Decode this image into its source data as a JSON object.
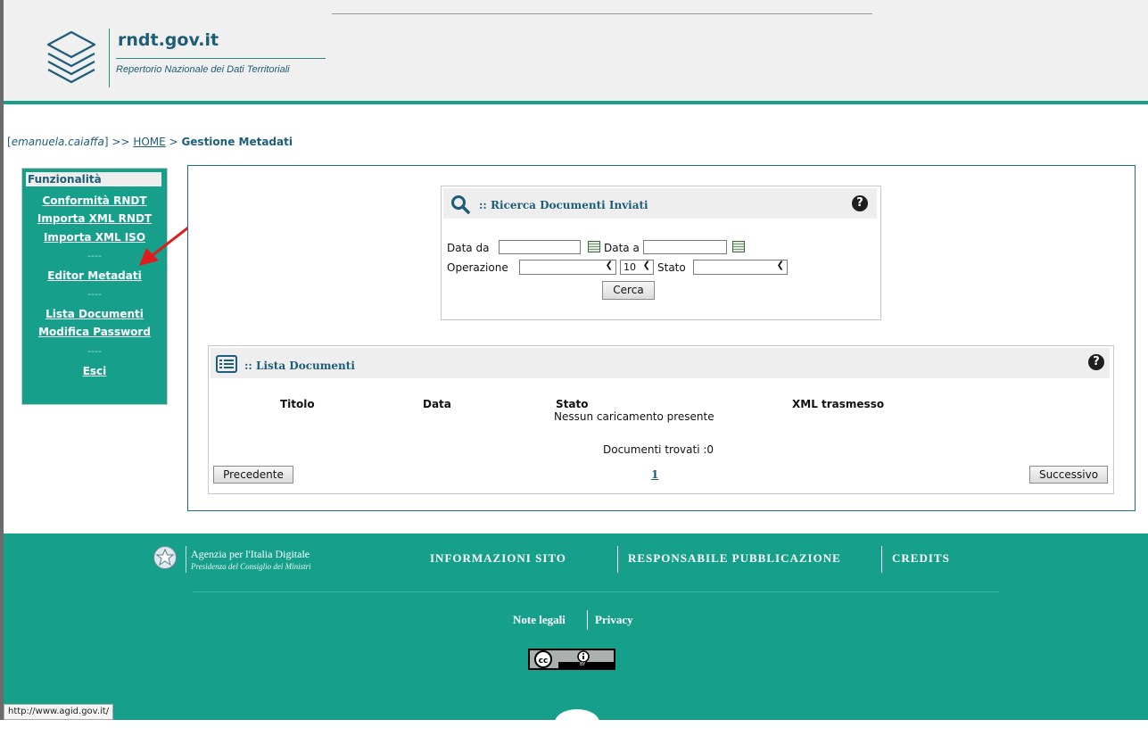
{
  "header": {
    "logo_title": "rndt.gov.it",
    "logo_subtitle": "Repertorio Nazionale dei Dati Territoriali"
  },
  "breadcrumb": {
    "user": "emanuela.caiaffa",
    "sep1": ">>",
    "home": "HOME",
    "sep2": ">",
    "current": "Gestione Metadati"
  },
  "sidebar": {
    "heading": "Funzionalità",
    "items": [
      {
        "label": "Conformità RNDT"
      },
      {
        "label": "Importa XML RNDT"
      },
      {
        "label": "Importa XML ISO"
      },
      {
        "label": "Editor Metadati"
      },
      {
        "label": "Lista Documenti"
      },
      {
        "label": "Modifica Password"
      },
      {
        "label": "Esci"
      }
    ],
    "separator": "----"
  },
  "search": {
    "title": ":: Ricerca Documenti Inviati",
    "help": "?",
    "date_from_label": "Data da",
    "date_to_label": "Data a",
    "date_from_value": "",
    "date_to_value": "",
    "operation_label": "Operazione",
    "operation_value": "",
    "page_size_value": "10",
    "state_label": "Stato",
    "state_value": "",
    "search_button": "Cerca"
  },
  "list": {
    "title": ":: Lista Documenti",
    "help": "?",
    "columns": [
      "Titolo",
      "Data",
      "Stato",
      "XML trasmesso"
    ],
    "empty_message": "Nessun caricamento presente",
    "found_text": "Documenti trovati :0",
    "prev_button": "Precedente",
    "next_button": "Successivo",
    "page": "1"
  },
  "footer": {
    "org_name": "Agenzia per l'Italia Digitale",
    "org_sub": "Presidenza del Consiglio dei Ministri",
    "links": [
      "INFORMAZIONI SITO",
      "RESPONSABILE PUBBLICAZIONE",
      "CREDITS"
    ],
    "legal": "Note legali",
    "privacy": "Privacy",
    "cc_text": "BY"
  },
  "status_bar": {
    "url": "http://www.agid.gov.it/"
  },
  "colors": {
    "teal": "#16a08c",
    "dark_blue": "#1d5d77",
    "arrow_red": "#e01b1b"
  }
}
